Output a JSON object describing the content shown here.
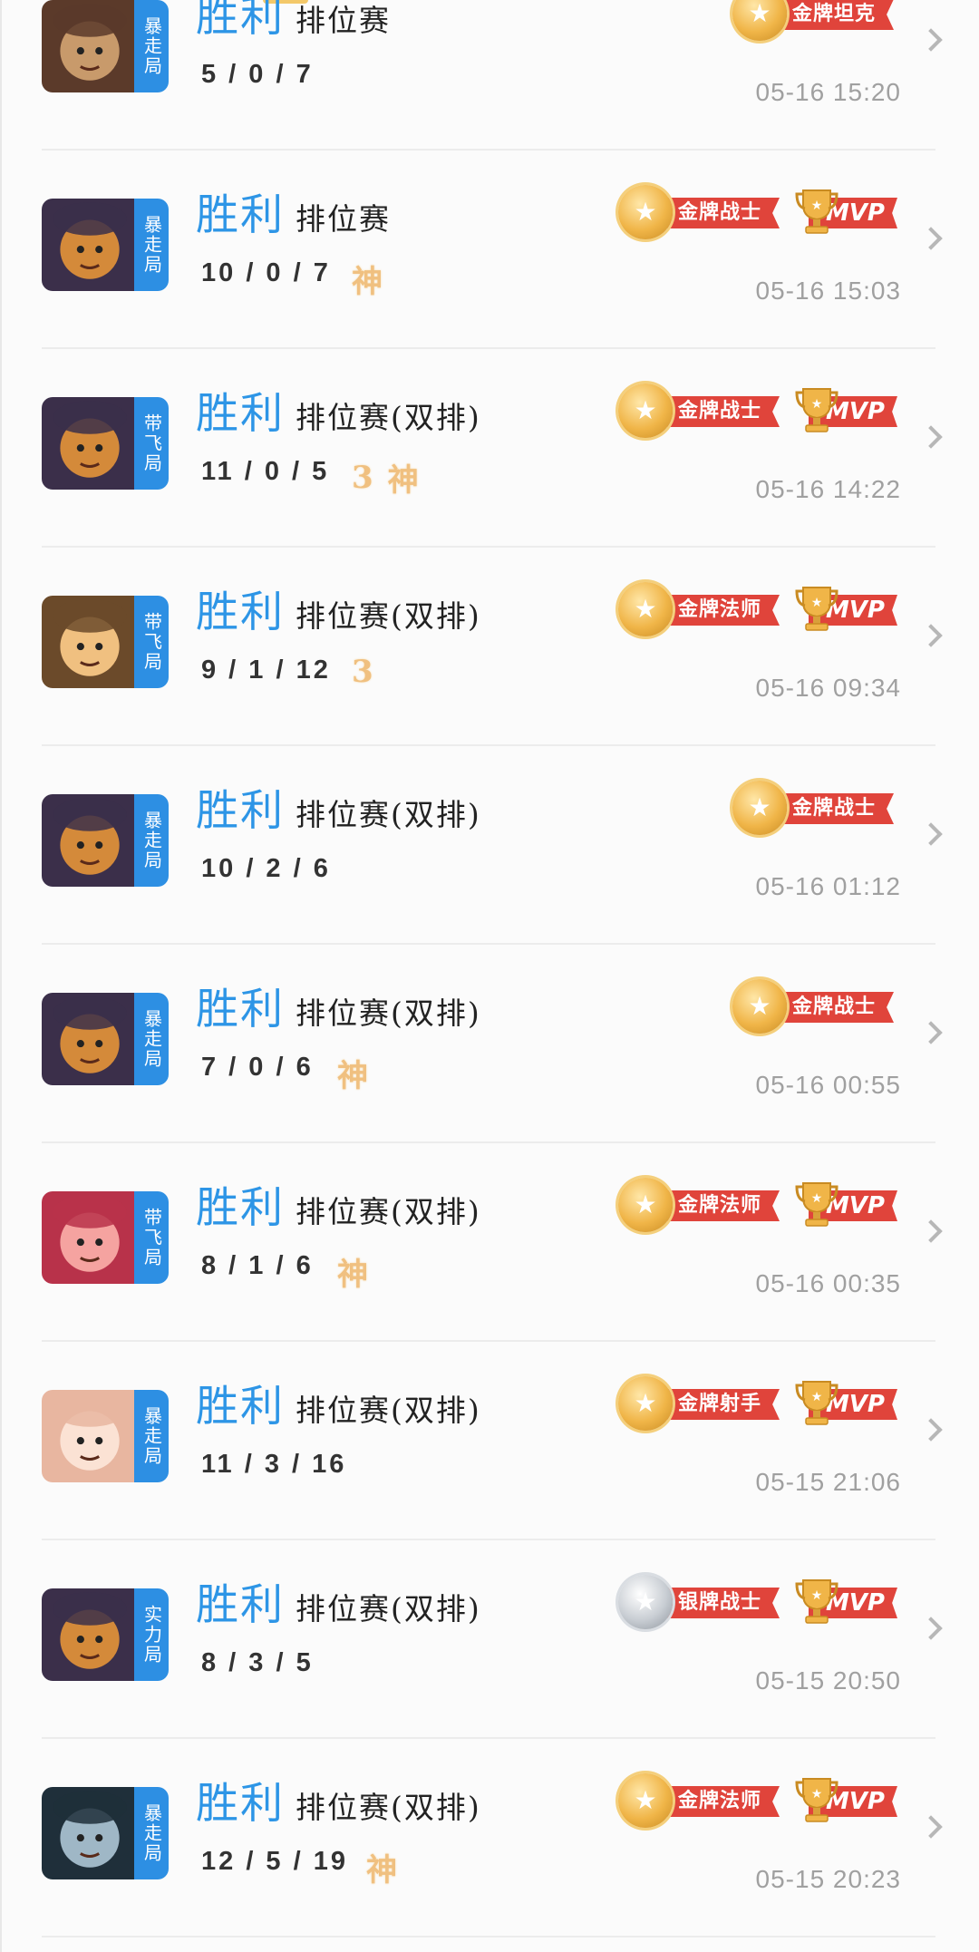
{
  "colors": {
    "result_blue": "#2d95e6",
    "mode_tag_blue": "#2d8fe3",
    "medal_red": "#e0443b",
    "gold": "#f0b548",
    "time_grey": "#a0a0a0"
  },
  "matches": [
    {
      "mode_tag": "暴走局",
      "result": "胜利",
      "mode": "排位赛",
      "kda": "5/0/7",
      "badges": [],
      "medal": {
        "label": "金牌坦克",
        "tier": "gold"
      },
      "mvp": false,
      "time": "05-16 15:20",
      "hero_icon": "hero-portrait-icon"
    },
    {
      "mode_tag": "暴走局",
      "result": "胜利",
      "mode": "排位赛",
      "kda": "10/0/7",
      "badges": [
        "神"
      ],
      "medal": {
        "label": "金牌战士",
        "tier": "gold"
      },
      "mvp": true,
      "mvp_label": "MVP",
      "time": "05-16 15:03",
      "hero_icon": "hero-portrait-icon"
    },
    {
      "mode_tag": "带飞局",
      "result": "胜利",
      "mode": "排位赛(双排)",
      "kda": "11/0/5",
      "badges": [
        "3",
        "神"
      ],
      "medal": {
        "label": "金牌战士",
        "tier": "gold"
      },
      "mvp": true,
      "mvp_label": "MVP",
      "time": "05-16 14:22",
      "hero_icon": "hero-portrait-icon"
    },
    {
      "mode_tag": "带飞局",
      "result": "胜利",
      "mode": "排位赛(双排)",
      "kda": "9/1/12",
      "badges": [
        "3"
      ],
      "medal": {
        "label": "金牌法师",
        "tier": "gold"
      },
      "mvp": true,
      "mvp_label": "MVP",
      "time": "05-16 09:34",
      "hero_icon": "hero-portrait-icon"
    },
    {
      "mode_tag": "暴走局",
      "result": "胜利",
      "mode": "排位赛(双排)",
      "kda": "10/2/6",
      "badges": [],
      "medal": {
        "label": "金牌战士",
        "tier": "gold"
      },
      "mvp": false,
      "time": "05-16 01:12",
      "hero_icon": "hero-portrait-icon"
    },
    {
      "mode_tag": "暴走局",
      "result": "胜利",
      "mode": "排位赛(双排)",
      "kda": "7/0/6",
      "badges": [
        "神"
      ],
      "medal": {
        "label": "金牌战士",
        "tier": "gold"
      },
      "mvp": false,
      "time": "05-16 00:55",
      "hero_icon": "hero-portrait-icon"
    },
    {
      "mode_tag": "带飞局",
      "result": "胜利",
      "mode": "排位赛(双排)",
      "kda": "8/1/6",
      "badges": [
        "神"
      ],
      "medal": {
        "label": "金牌法师",
        "tier": "gold"
      },
      "mvp": true,
      "mvp_label": "MVP",
      "time": "05-16 00:35",
      "hero_icon": "hero-portrait-icon"
    },
    {
      "mode_tag": "暴走局",
      "result": "胜利",
      "mode": "排位赛(双排)",
      "kda": "11/3/16",
      "badges": [],
      "medal": {
        "label": "金牌射手",
        "tier": "gold"
      },
      "mvp": true,
      "mvp_label": "MVP",
      "time": "05-15 21:06",
      "hero_icon": "hero-portrait-icon"
    },
    {
      "mode_tag": "实力局",
      "result": "胜利",
      "mode": "排位赛(双排)",
      "kda": "8/3/5",
      "badges": [],
      "medal": {
        "label": "银牌战士",
        "tier": "silver"
      },
      "mvp": true,
      "mvp_label": "MVP",
      "time": "05-15 20:50",
      "hero_icon": "hero-portrait-icon"
    },
    {
      "mode_tag": "暴走局",
      "result": "胜利",
      "mode": "排位赛(双排)",
      "kda": "12/5/19",
      "badges": [
        "神"
      ],
      "medal": {
        "label": "金牌法师",
        "tier": "gold"
      },
      "mvp": true,
      "mvp_label": "MVP",
      "time": "05-15 20:23",
      "hero_icon": "hero-portrait-icon"
    }
  ]
}
